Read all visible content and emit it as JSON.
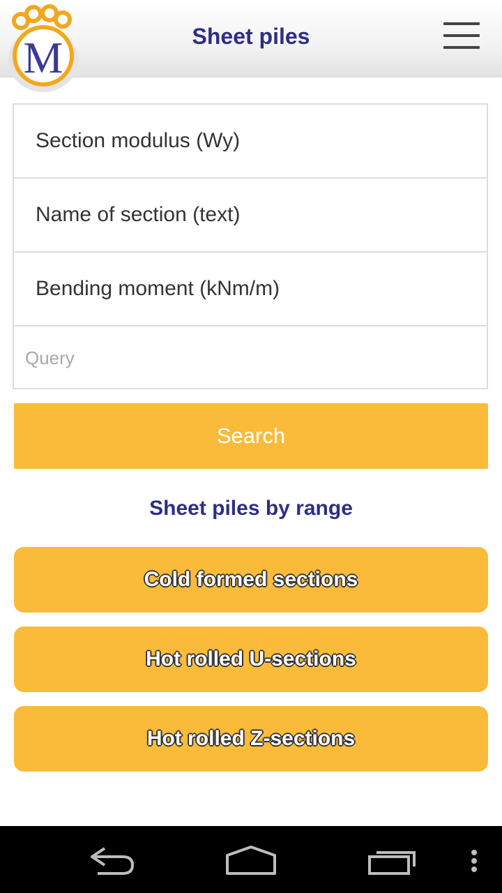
{
  "header": {
    "title": "Sheet piles",
    "logo_letter": "M"
  },
  "filters": {
    "items": [
      {
        "label": "Section modulus (Wy)"
      },
      {
        "label": "Name of section (text)"
      },
      {
        "label": "Bending moment (kNm/m)"
      }
    ],
    "query_placeholder": "Query",
    "query_value": ""
  },
  "search_label": "Search",
  "range": {
    "title": "Sheet piles by range",
    "buttons": [
      {
        "label": "Cold formed sections"
      },
      {
        "label": "Hot rolled U-sections"
      },
      {
        "label": "Hot rolled Z-sections"
      }
    ]
  },
  "navbar": {
    "icons": [
      "back-icon",
      "home-icon",
      "recent-apps-icon",
      "overflow-menu-icon"
    ]
  },
  "colors": {
    "accent": "#f9bb39",
    "title": "#2e2e86",
    "logo_ring": "#f2a81d",
    "logo_letter": "#3a3a96"
  }
}
